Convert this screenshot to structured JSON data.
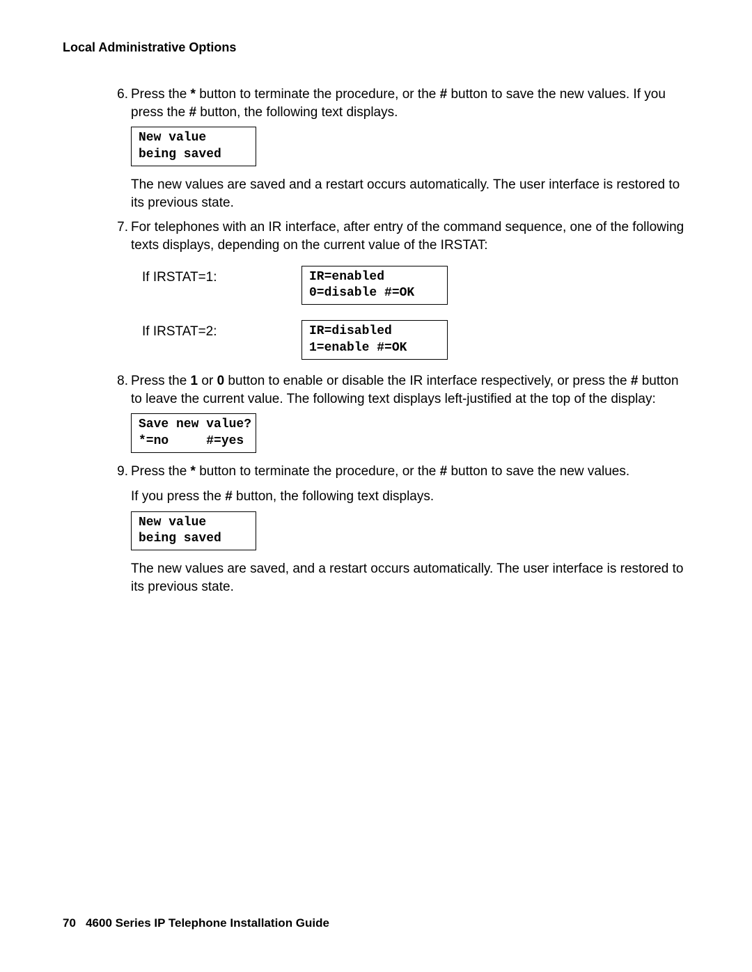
{
  "header": {
    "title": "Local Administrative Options"
  },
  "steps": {
    "s6": {
      "num": "6.",
      "text_before1": "Press the ",
      "star1": "*",
      "text_mid1": " button to terminate the procedure, or the ",
      "hash1": "#",
      "text_after1": " button to save the new values. If you press the ",
      "hash2": "#",
      "text_end": " button, the following text displays.",
      "box": "New value\nbeing saved",
      "para": "The new values are saved and a restart occurs automatically. The user interface is restored to its previous state."
    },
    "s7": {
      "num": "7.",
      "text": "For telephones with an IR interface, after entry of the command sequence, one of the following texts displays, depending on the current value of the IRSTAT:",
      "row1_label": "If IRSTAT=1:",
      "row1_box": "IR=enabled\n0=disable #=OK",
      "row2_label": "If IRSTAT=2:",
      "row2_box": "IR=disabled\n1=enable #=OK"
    },
    "s8": {
      "num": "8.",
      "t1": "Press the ",
      "b1": "1",
      "t2": " or ",
      "b0": "0",
      "t3": " button to enable or disable the IR interface respectively, or press the ",
      "hash": "#",
      "t4": " button to leave the current value. The following text displays left-justified at the top of the display:",
      "box": "Save new value?\n*=no     #=yes"
    },
    "s9": {
      "num": "9.",
      "t1": "Press the ",
      "star": "*",
      "t2": " button to terminate the procedure, or the ",
      "hash1": "#",
      "t3": " button to save the new values.",
      "line2a": "If you press the ",
      "hash2": "#",
      "line2b": " button, the following text displays.",
      "box": "New value\nbeing saved",
      "para": "The new values are saved, and a restart occurs automatically. The user interface is restored to its previous state."
    }
  },
  "footer": {
    "page_num": "70",
    "title": "4600 Series IP Telephone Installation Guide"
  }
}
